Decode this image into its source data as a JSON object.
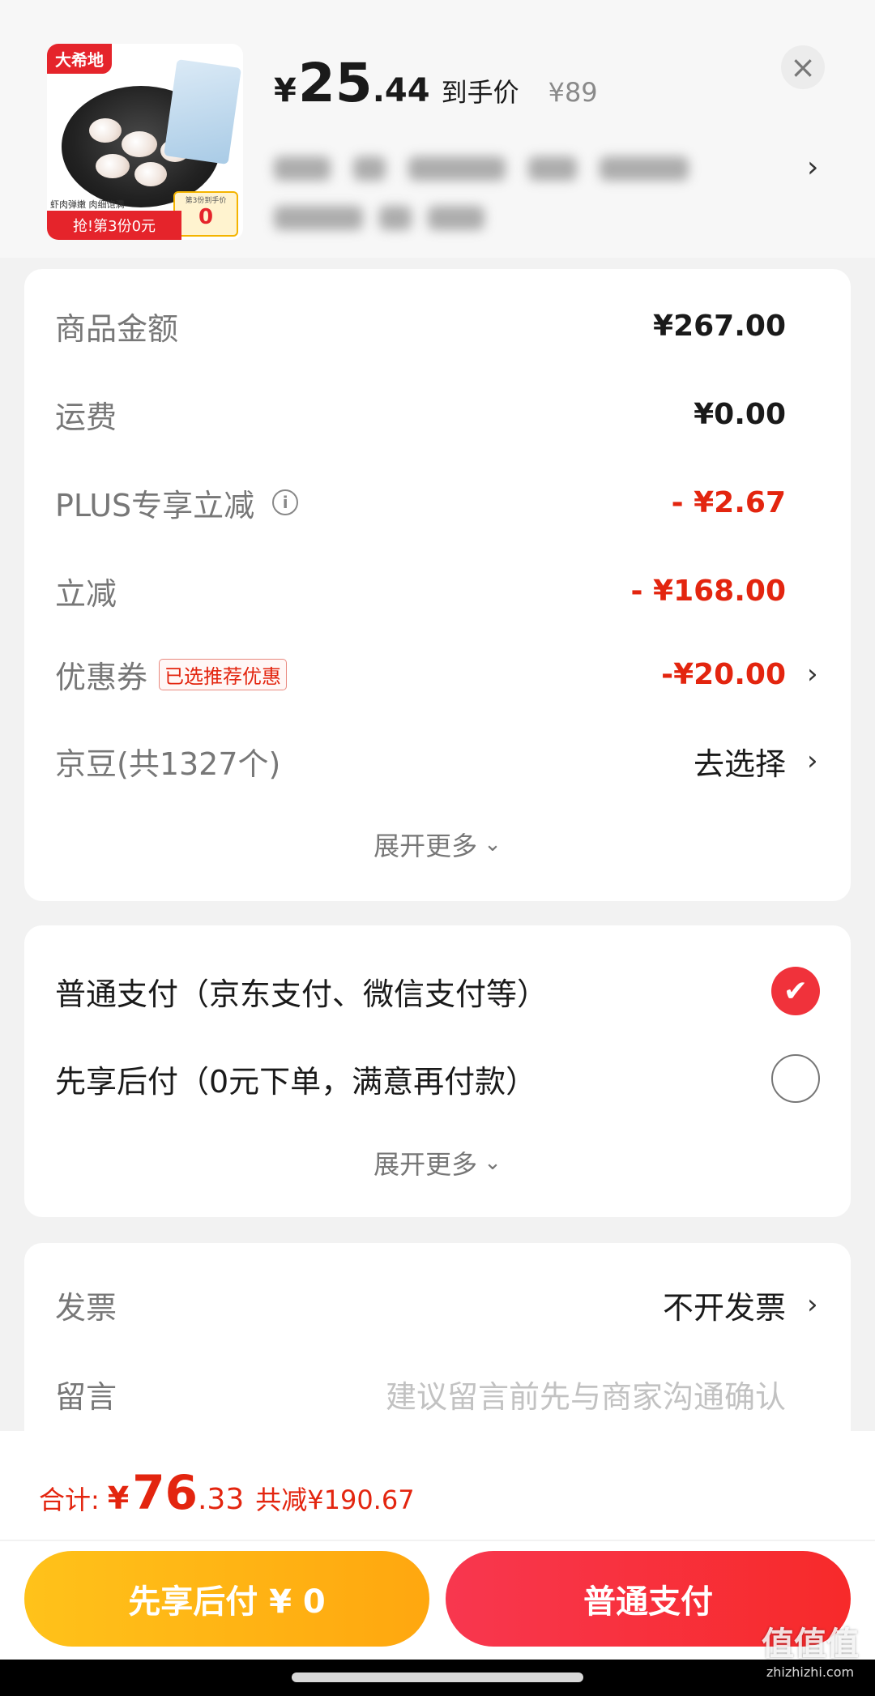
{
  "product": {
    "brand": "大希地",
    "thumb_caption": "虾肉弹嫩 肉细饱满",
    "thumb_tag_small": "第3份到手价",
    "thumb_tag_value": "0",
    "thumb_promo": "抢!第3份0元",
    "price_yen": "¥",
    "price_int": "25",
    "price_dec": ".44",
    "price_label": "到手价",
    "original_price": "¥89"
  },
  "summary": {
    "goods_label": "商品金额",
    "goods_value": "¥267.00",
    "shipping_label": "运费",
    "shipping_value": "¥0.00",
    "plus_label": "PLUS专享立减",
    "plus_value": "- ¥2.67",
    "discount_label": "立减",
    "discount_value": "- ¥168.00",
    "coupon_label": "优惠券",
    "coupon_tag": "已选推荐优惠",
    "coupon_value": "-¥20.00",
    "beans_label": "京豆(共1327个)",
    "beans_value": "去选择",
    "expand_label": "展开更多"
  },
  "payment": {
    "normal_label": "普通支付（京东支付、微信支付等）",
    "normal_selected": true,
    "later_label": "先享后付（0元下单，满意再付款）",
    "later_selected": false,
    "expand_label": "展开更多"
  },
  "extras": {
    "invoice_label": "发票",
    "invoice_value": "不开发票",
    "note_label": "留言",
    "note_placeholder": "建议留言前先与商家沟通确认"
  },
  "footer": {
    "total_label": "合计:",
    "total_yen": "¥",
    "total_int": "76",
    "total_dec": ".33",
    "total_saved": "共减¥190.67",
    "later_button": "先享后付 ¥ 0",
    "pay_button": "普通支付"
  },
  "watermark": {
    "main": "值值值",
    "sub": "zhizhizhi.com"
  },
  "colors": {
    "accent_red": "#e3250f",
    "pay_button": "#f72a2a",
    "later_button": "#ffb315"
  }
}
